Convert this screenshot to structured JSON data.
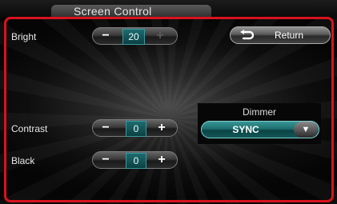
{
  "header": {
    "title": "Screen Control"
  },
  "bright": {
    "label": "Bright",
    "minus": "−",
    "value": "20",
    "plus": "+",
    "plus_enabled": false
  },
  "contrast": {
    "label": "Contrast",
    "minus": "−",
    "value": "0",
    "plus": "+"
  },
  "black": {
    "label": "Black",
    "minus": "−",
    "value": "0",
    "plus": "+"
  },
  "return_button": {
    "label": "Return",
    "icon": "return-arrow-icon"
  },
  "dimmer": {
    "label": "Dimmer",
    "value": "SYNC",
    "arrow": "▼"
  },
  "colors": {
    "highlight": "#d8131e",
    "accent": "#1d6b6f"
  }
}
